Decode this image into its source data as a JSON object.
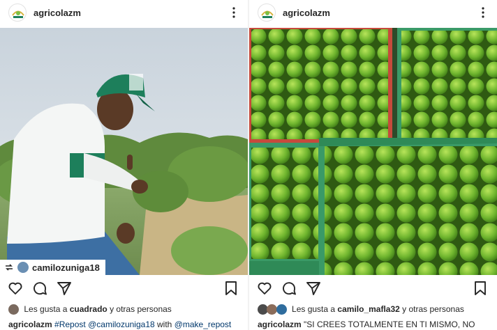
{
  "left_post": {
    "username": "agricolazm",
    "repost_username": "camilozuniga18",
    "likes": {
      "prefix": "Les gusta a",
      "user": "cuadrado",
      "suffix": "y otras personas"
    },
    "caption": {
      "user": "agricolazm",
      "hashtag": "#Repost",
      "mention1": "@camilozuniga18",
      "word": "with",
      "mention2": "@make_repost"
    }
  },
  "right_post": {
    "username": "agricolazm",
    "likes": {
      "prefix": "Les gusta a",
      "user": "camilo_mafla32",
      "suffix": "y otras personas"
    },
    "caption": {
      "user": "agricolazm",
      "text": "\"SI CREES TOTALMENTE EN TI MISMO, NO"
    }
  },
  "colors": {
    "accent_green": "#1d7f5b",
    "lime": "#7cc043",
    "crate_red": "#c64a3c",
    "crate_green": "#3a9a67"
  },
  "icons": [
    "more-options-icon",
    "heart-icon",
    "comment-icon",
    "share-icon",
    "bookmark-icon",
    "repost-icon"
  ]
}
